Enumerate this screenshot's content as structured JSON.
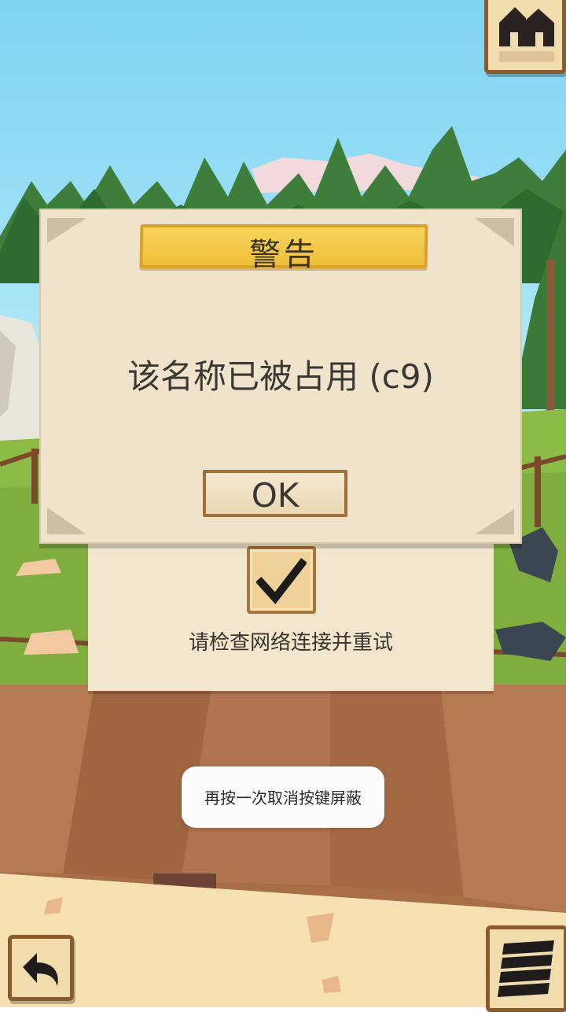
{
  "dialog": {
    "title": "警告",
    "message": "该名称已被占用 (c9)",
    "ok_label": "OK"
  },
  "panel": {
    "network_message": "请检查网络连接并重试"
  },
  "toast": {
    "text": "再按一次取消按键屏蔽"
  },
  "icons": {
    "home": "home-icon",
    "back": "back-arrow-icon",
    "menu": "stack-menu-icon",
    "check": "checkmark-icon"
  },
  "colors": {
    "title_bar": "#f2c843",
    "parchment": "#efe3cc",
    "wood_border": "#8c5a2f",
    "sky": "#8fdaf4",
    "grass": "#7fae3e",
    "deck": "#a86e48",
    "sand": "#f7e1b2"
  }
}
